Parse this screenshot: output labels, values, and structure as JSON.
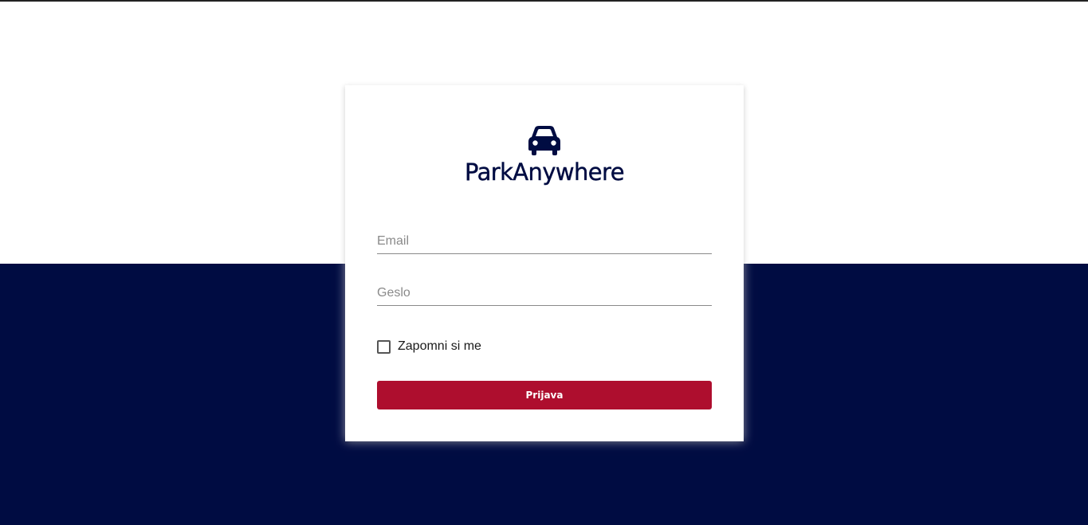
{
  "app": {
    "brand_name": "ParkAnywhere",
    "logo_icon": "car-icon"
  },
  "login_form": {
    "email_placeholder": "Email",
    "email_value": "",
    "password_placeholder": "Geslo",
    "password_value": "",
    "remember_label": "Zapomni si me",
    "remember_checked": false,
    "submit_label": "Prijava"
  },
  "colors": {
    "brand_navy": "#000c42",
    "button_red": "#ae0e2e",
    "background_top": "#ffffff"
  }
}
